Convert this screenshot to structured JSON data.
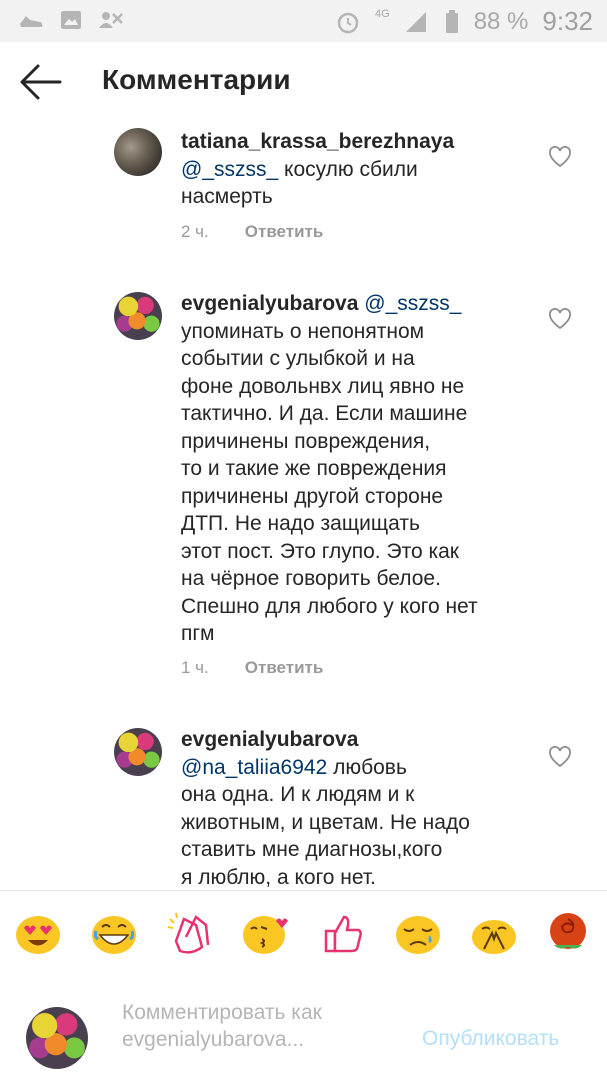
{
  "status_bar": {
    "network": "4G",
    "battery": "88 %",
    "time": "9:32",
    "icons": [
      "shoe-icon",
      "gallery-icon",
      "contacts-icon",
      "alarm-icon",
      "signal-icon",
      "battery-icon"
    ]
  },
  "header": {
    "title": "Комментарии",
    "back_icon": "back-arrow-icon"
  },
  "comments": [
    {
      "username": "tatiana_krassa_berezhnaya",
      "mention": "@_sszss_",
      "text_line_1": " косулю сбили",
      "text_line_2": "насмерть",
      "time": "2 ч.",
      "reply": "Ответить"
    },
    {
      "username": "evgenialyubarova",
      "mention": "@_sszss_",
      "lines": [
        "упоминать о непонятном",
        "событии с улыбкой и на",
        "фоне довольнвх лиц явно не",
        "тактично. И да. Если машине",
        "причинены повреждения,",
        "то и такие же повреждения",
        "причинены другой стороне",
        "ДТП. Не надо защищать",
        "этот пост. Это глупо. Это как",
        "на чёрное говорить белое.",
        "Спешно для любого у кого нет",
        "пгм"
      ],
      "time": "1 ч.",
      "reply": "Ответить"
    },
    {
      "username": "evgenialyubarova",
      "mention": "@na_taliia6942",
      "text_first": " любовь",
      "lines": [
        "она одна. И к людям и к",
        "животным, и цветам. Не надо",
        "ставить мне диагнозы,кого",
        "я люблю, а кого нет."
      ]
    }
  ],
  "emoji_bar": [
    "heart-eyes-emoji",
    "grinning-emoji",
    "clapping-emoji",
    "kiss-emoji",
    "thumbs-up-emoji",
    "sad-emoji",
    "praying-emoji",
    "rose-emoji"
  ],
  "composer": {
    "placeholder": "Комментировать как evgenialyubarova...",
    "publish": "Опубликовать"
  },
  "colors": {
    "link": "#003569",
    "muted": "#999999",
    "publish_disabled": "#b2dffc",
    "emoji_yellow": "#f9c623"
  }
}
